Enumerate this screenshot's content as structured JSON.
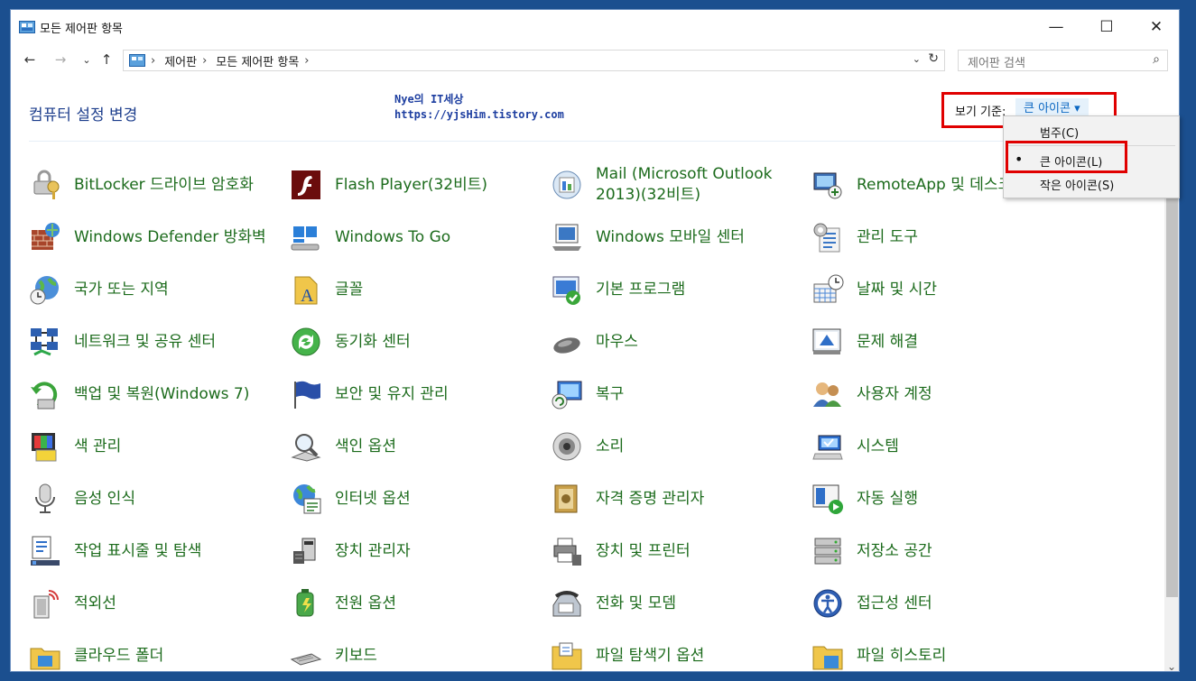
{
  "window": {
    "title": "모든 제어판 항목",
    "minimize": "—",
    "maximize": "☐",
    "close": "✕"
  },
  "nav": {
    "back": "←",
    "forward": "→",
    "recent": "⌄",
    "up": "↑"
  },
  "address": {
    "crumbs": [
      "제어판",
      "모든 제어판 항목"
    ],
    "separator": "›",
    "dropdown": "⌄",
    "refresh": "↻"
  },
  "search": {
    "placeholder": "제어판 검색",
    "icon": "search-icon"
  },
  "header": {
    "heading": "컴퓨터 설정 변경",
    "view_by_label": "보기 기준:",
    "view_by_value": "큰 아이콘 ▾"
  },
  "watermark": {
    "line1": "Nye의 IT세상",
    "line2": "https://yjsHim.tistory.com"
  },
  "view_menu": {
    "items": [
      "범주(C)",
      "큰 아이콘(L)",
      "작은 아이콘(S)"
    ],
    "selected": "큰 아이콘(L)",
    "bullet": "•"
  },
  "items": [
    {
      "label": "BitLocker 드라이브 암호화",
      "icon": "bitlocker-icon"
    },
    {
      "label": "Flash Player(32비트)",
      "icon": "flash-icon"
    },
    {
      "label": "Mail (Microsoft Outlook 2013)(32비트)",
      "icon": "mail-icon"
    },
    {
      "label": "RemoteApp 및 데스크톱 연결",
      "icon": "remoteapp-icon"
    },
    {
      "label": "Windows Defender 방화벽",
      "icon": "firewall-icon"
    },
    {
      "label": "Windows To Go",
      "icon": "windows-to-go-icon"
    },
    {
      "label": "Windows 모바일 센터",
      "icon": "mobility-center-icon"
    },
    {
      "label": "관리 도구",
      "icon": "admin-tools-icon"
    },
    {
      "label": "국가 또는 지역",
      "icon": "region-icon"
    },
    {
      "label": "글꼴",
      "icon": "fonts-icon"
    },
    {
      "label": "기본 프로그램",
      "icon": "default-programs-icon"
    },
    {
      "label": "날짜 및 시간",
      "icon": "date-time-icon"
    },
    {
      "label": "네트워크 및 공유 센터",
      "icon": "network-icon"
    },
    {
      "label": "동기화 센터",
      "icon": "sync-center-icon"
    },
    {
      "label": "마우스",
      "icon": "mouse-icon"
    },
    {
      "label": "문제 해결",
      "icon": "troubleshoot-icon"
    },
    {
      "label": "백업 및 복원(Windows 7)",
      "icon": "backup-icon"
    },
    {
      "label": "보안 및 유지 관리",
      "icon": "security-flag-icon"
    },
    {
      "label": "복구",
      "icon": "recovery-icon"
    },
    {
      "label": "사용자 계정",
      "icon": "user-accounts-icon"
    },
    {
      "label": "색 관리",
      "icon": "color-management-icon"
    },
    {
      "label": "색인 옵션",
      "icon": "indexing-icon"
    },
    {
      "label": "소리",
      "icon": "sound-icon"
    },
    {
      "label": "시스템",
      "icon": "system-icon"
    },
    {
      "label": "음성 인식",
      "icon": "speech-icon"
    },
    {
      "label": "인터넷 옵션",
      "icon": "internet-options-icon"
    },
    {
      "label": "자격 증명 관리자",
      "icon": "credential-icon"
    },
    {
      "label": "자동 실행",
      "icon": "autoplay-icon"
    },
    {
      "label": "작업 표시줄 및 탐색",
      "icon": "taskbar-icon"
    },
    {
      "label": "장치 관리자",
      "icon": "device-manager-icon"
    },
    {
      "label": "장치 및 프린터",
      "icon": "printer-icon"
    },
    {
      "label": "저장소 공간",
      "icon": "storage-icon"
    },
    {
      "label": "적외선",
      "icon": "infrared-icon"
    },
    {
      "label": "전원 옵션",
      "icon": "power-icon"
    },
    {
      "label": "전화 및 모뎀",
      "icon": "phone-icon"
    },
    {
      "label": "접근성 센터",
      "icon": "ease-of-access-icon"
    },
    {
      "label": "클라우드 폴더",
      "icon": "cloud-folder-icon"
    },
    {
      "label": "키보드",
      "icon": "keyboard-icon"
    },
    {
      "label": "파일 탐색기 옵션",
      "icon": "explorer-options-icon"
    },
    {
      "label": "파일 히스토리",
      "icon": "file-history-icon"
    }
  ],
  "scroll": {
    "down": "⌄"
  }
}
